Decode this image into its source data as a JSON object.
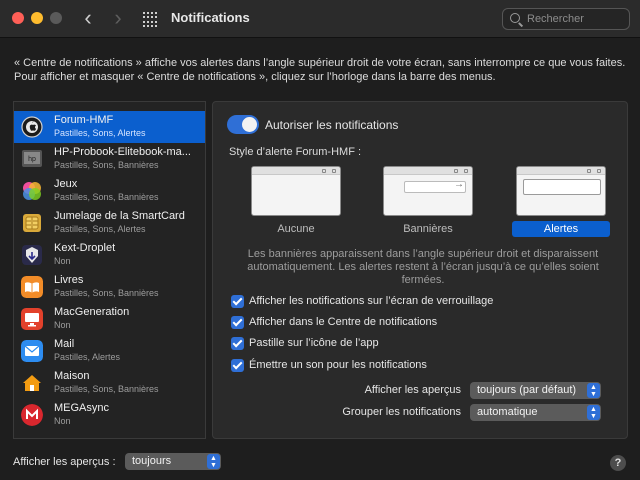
{
  "window": {
    "title": "Notifications"
  },
  "search": {
    "placeholder": "Rechercher"
  },
  "description": "« Centre de notifications » affiche vos alertes dans l’angle supérieur droit de votre écran, sans interrompre ce que vous faites. Pour afficher et masquer « Centre de notifications », cliquez sur l’horloge dans la barre des menus.",
  "apps": [
    {
      "name": "Forum-HMF",
      "sub": "Pastilles, Sons, Alertes",
      "icon": "forum-hmf-icon",
      "selected": true
    },
    {
      "name": "HP-Probook-Elitebook-ma...",
      "sub": "Pastilles, Sons, Bannières",
      "icon": "hp-probook-icon"
    },
    {
      "name": "Jeux",
      "sub": "Pastilles, Sons, Bannières",
      "icon": "game-center-icon"
    },
    {
      "name": "Jumelage de la SmartCard",
      "sub": "Pastilles, Sons, Alertes",
      "icon": "smartcard-icon"
    },
    {
      "name": "Kext-Droplet",
      "sub": "Non",
      "icon": "kext-droplet-icon"
    },
    {
      "name": "Livres",
      "sub": "Pastilles, Sons, Bannières",
      "icon": "books-icon"
    },
    {
      "name": "MacGeneration",
      "sub": "Non",
      "icon": "macgeneration-icon"
    },
    {
      "name": "Mail",
      "sub": "Pastilles, Alertes",
      "icon": "mail-icon"
    },
    {
      "name": "Maison",
      "sub": "Pastilles, Sons, Bannières",
      "icon": "home-icon"
    },
    {
      "name": "MEGAsync",
      "sub": "Non",
      "icon": "megasync-icon"
    }
  ],
  "panel": {
    "allow_label": "Autoriser les notifications",
    "allow_enabled": true,
    "style_title": "Style d’alerte Forum-HMF :",
    "styles": [
      {
        "label": "Aucune",
        "selected": false
      },
      {
        "label": "Bannières",
        "selected": false
      },
      {
        "label": "Alertes",
        "selected": true
      }
    ],
    "note": "Les bannières apparaissent dans l’angle supérieur droit et disparaissent automatiquement. Les alertes restent à l’écran jusqu’à ce qu’elles soient fermées.",
    "checkboxes": [
      {
        "label": "Afficher les notifications sur l’écran de verrouillage",
        "checked": true
      },
      {
        "label": "Afficher dans le Centre de notifications",
        "checked": true
      },
      {
        "label": "Pastille sur l’icône de l’app",
        "checked": true
      },
      {
        "label": "Émettre un son pour les notifications",
        "checked": true
      }
    ],
    "previews_label": "Afficher les aperçus",
    "previews_value": "toujours (par défaut)",
    "group_label": "Grouper les notifications",
    "group_value": "automatique"
  },
  "bottom": {
    "previews_label": "Afficher les aperçus :",
    "previews_value": "toujours"
  },
  "help": "?",
  "colors": {
    "accent": "#0b5fce",
    "toggle": "#2f6fd6",
    "background": "#1e1e1e"
  }
}
